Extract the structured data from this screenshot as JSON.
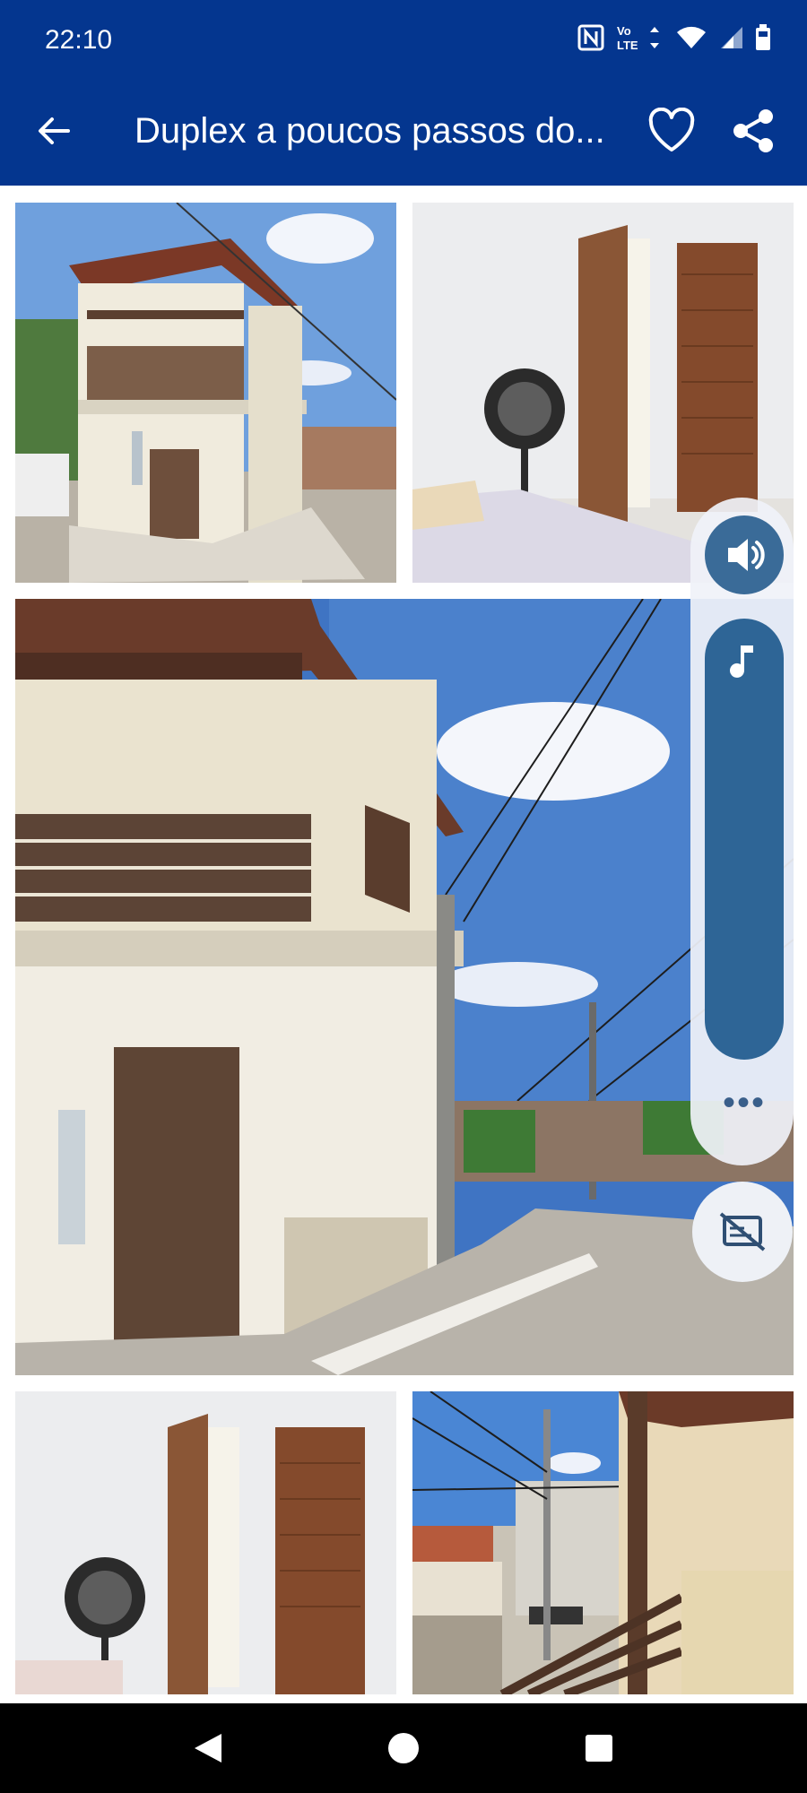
{
  "status_bar": {
    "time": "22:10",
    "icons": [
      "nfc-icon",
      "volte-icon",
      "wifi-icon",
      "signal-icon",
      "battery-icon"
    ]
  },
  "app_bar": {
    "title": "Duplex a poucos passos do..."
  },
  "photos": [
    "photo-exterior-corner",
    "photo-bedroom-doors",
    "photo-exterior-large",
    "photo-bedroom-doors-2",
    "photo-balcony-street"
  ],
  "overlay_controls": [
    "volume-icon",
    "music-note-icon",
    "more-icon",
    "captions-off-icon"
  ],
  "colors": {
    "brand": "#04368f",
    "accent": "#2e6596"
  }
}
